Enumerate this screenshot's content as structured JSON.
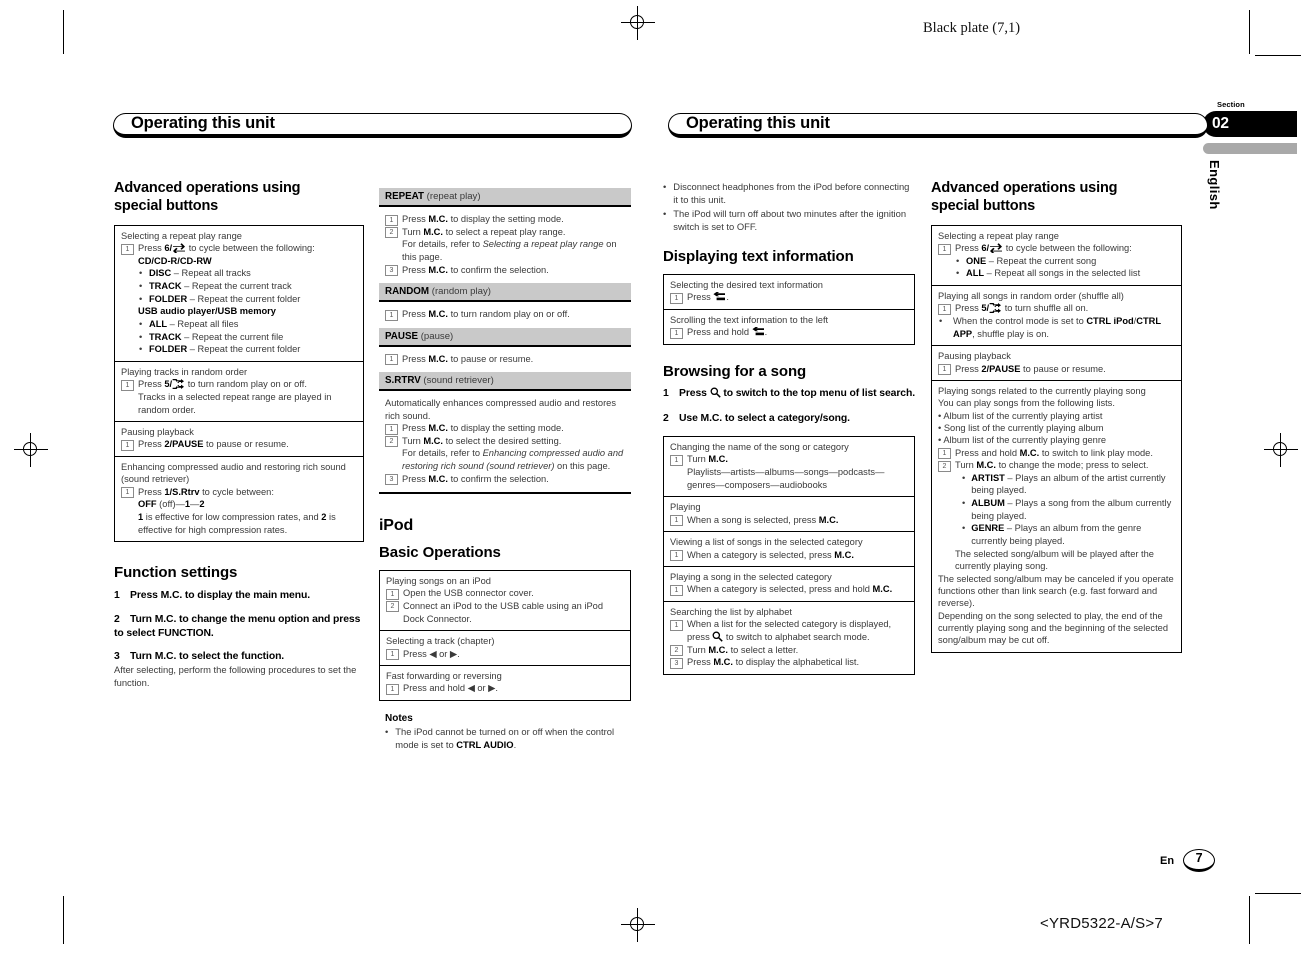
{
  "print_marks": {
    "plate_label": "Black plate (7,1)",
    "footer_code": "<YRD5322-A/S>7"
  },
  "section_tab": {
    "label": "Section",
    "number": "02",
    "language": "English"
  },
  "page_footer": {
    "lang_code": "En",
    "page_number": "7"
  },
  "running_head": {
    "left": "Operating this unit",
    "right": "Operating this unit"
  },
  "column1": {
    "heading": "Advanced operations using special buttons",
    "boxes": [
      {
        "title": "Selecting a repeat play range",
        "steps": [
          {
            "n": "1",
            "text_pre": "Press ",
            "bold": "6/",
            "icon": "repeat-icon",
            "text_post": " to cycle between the following:"
          }
        ],
        "group1_label": "CD/CD-R/CD-RW",
        "group1_items": [
          {
            "term": "DISC",
            "desc": " – Repeat all tracks"
          },
          {
            "term": "TRACK",
            "desc": " – Repeat the current track"
          },
          {
            "term": "FOLDER",
            "desc": " – Repeat the current folder"
          }
        ],
        "group2_label": "USB audio player/USB memory",
        "group2_items": [
          {
            "term": "ALL",
            "desc": " – Repeat all files"
          },
          {
            "term": "TRACK",
            "desc": " – Repeat the current file"
          },
          {
            "term": "FOLDER",
            "desc": " – Repeat the current folder"
          }
        ]
      },
      {
        "title": "Playing tracks in random order",
        "step_pre": "Press ",
        "step_bold": "5/",
        "step_icon": "shuffle-icon",
        "step_post": " to turn random play on or off.",
        "note": "Tracks in a selected repeat range are played in random order."
      },
      {
        "title": "Pausing playback",
        "step_pre": "Press ",
        "step_bold": "2/PAUSE",
        "step_post": " to pause or resume."
      },
      {
        "title": "Enhancing compressed audio and restoring rich sound (sound retriever)",
        "step_pre": "Press ",
        "step_bold": "1/S.Rtrv",
        "step_post": " to cycle between:",
        "values": "OFF (off)—1—2",
        "values_bold_1": "OFF",
        "values_plain_1": " (off)—",
        "values_bold_2": "1",
        "values_plain_2": "—",
        "values_bold_3": "2",
        "note_a": "1",
        "note_b": " is effective for low compression rates, and ",
        "note_c": "2",
        "note_d": " is effective for high compression rates."
      }
    ],
    "function_settings": {
      "heading": "Function settings",
      "steps": [
        {
          "n": "1",
          "text": "Press M.C. to display the main menu."
        },
        {
          "n": "2",
          "text": "Turn M.C. to change the menu option and press to select FUNCTION."
        },
        {
          "n": "3",
          "text": "Turn M.C. to select the function."
        }
      ],
      "after_note": "After selecting, perform the following procedures to set the function."
    }
  },
  "column2": {
    "strips": [
      {
        "name": "REPEAT",
        "paren": " (repeat play)",
        "lines": [
          {
            "n": "1",
            "pre": "Press ",
            "b": "M.C.",
            "post": " to display the setting mode."
          },
          {
            "n": "2",
            "pre": "Turn ",
            "b": "M.C.",
            "post": " to select a repeat play range."
          },
          {
            "cont": "For details, refer to ",
            "italic": "Selecting a repeat play range",
            "cont2": " on this page."
          },
          {
            "n": "3",
            "pre": "Press ",
            "b": "M.C.",
            "post": " to confirm the selection."
          }
        ]
      },
      {
        "name": "RANDOM",
        "paren": " (random play)",
        "lines": [
          {
            "n": "1",
            "pre": "Press ",
            "b": "M.C.",
            "post": " to turn random play on or off."
          }
        ]
      },
      {
        "name": "PAUSE",
        "paren": " (pause)",
        "lines": [
          {
            "n": "1",
            "pre": "Press ",
            "b": "M.C.",
            "post": " to pause or resume."
          }
        ]
      },
      {
        "name": "S.RTRV",
        "paren": " (sound retriever)",
        "intro": "Automatically enhances compressed audio and restores rich sound.",
        "lines": [
          {
            "n": "1",
            "pre": "Press ",
            "b": "M.C.",
            "post": " to display the setting mode."
          },
          {
            "n": "2",
            "pre": "Turn ",
            "b": "M.C.",
            "post": " to select the desired setting."
          },
          {
            "cont": "For details, refer to ",
            "italic": "Enhancing compressed audio and restoring rich sound (sound retriever)",
            "cont2": " on this page."
          },
          {
            "n": "3",
            "pre": "Press ",
            "b": "M.C.",
            "post": " to confirm the selection."
          }
        ]
      }
    ],
    "ipod_heading": "iPod",
    "basic_heading": "Basic Operations",
    "basic_boxes": [
      {
        "title": "Playing songs on an iPod",
        "steps": [
          {
            "n": "1",
            "text": "Open the USB connector cover."
          },
          {
            "n": "2",
            "text": "Connect an iPod to the USB cable using an iPod Dock Connector."
          }
        ]
      },
      {
        "title": "Selecting a track (chapter)",
        "steps": [
          {
            "n": "1",
            "text": "Press ◀ or ▶."
          }
        ]
      },
      {
        "title": "Fast forwarding or reversing",
        "steps": [
          {
            "n": "1",
            "text": "Press and hold ◀ or ▶."
          }
        ]
      }
    ],
    "notes_heading": "Notes",
    "notes": [
      {
        "pre": "The iPod cannot be turned on or off when the control mode is set to ",
        "b": "CTRL AUDIO",
        "post": "."
      }
    ]
  },
  "column3": {
    "top_notes": [
      {
        "text": "Disconnect headphones from the iPod before connecting it to this unit."
      },
      {
        "text": "The iPod will turn off about two minutes after the ignition switch is set to OFF."
      }
    ],
    "text_info_heading": "Displaying text information",
    "text_info_boxes": [
      {
        "title": "Selecting the desired text information",
        "step_n": "1",
        "step_pre": "Press ",
        "step_icon": "return-icon",
        "step_post": "."
      },
      {
        "title": "Scrolling the text information to the left",
        "step_n": "1",
        "step_pre": "Press and hold ",
        "step_icon": "return-icon",
        "step_post": "."
      }
    ],
    "browsing_heading": "Browsing for a song",
    "browsing_steps": [
      {
        "n": "1",
        "pre": "Press ",
        "icon": "search-icon",
        "post": " to switch to the top menu of list search."
      },
      {
        "n": "2",
        "pre": "Use M.C. to select a category/song.",
        "icon": "",
        "post": ""
      }
    ],
    "browsing_boxes": [
      {
        "title": "Changing the name of the song or category",
        "step_n": "1",
        "step_pre": "Turn ",
        "step_b": "M.C.",
        "sub1": "Playlists—artists—albums—songs—podcasts—genres—composers—audiobooks"
      },
      {
        "title": "Playing",
        "step_n": "1",
        "step_pre": "When a song is selected, press ",
        "step_b": "M.C."
      },
      {
        "title": "Viewing a list of songs in the selected category",
        "step_n": "1",
        "step_pre": "When a category is selected, press ",
        "step_b": "M.C."
      },
      {
        "title": "Playing a song in the selected category",
        "step_n": "1",
        "step_pre": "When a category is selected, press and hold ",
        "step_b": "M.C."
      },
      {
        "title": "Searching the list by alphabet",
        "step_n": "1",
        "step_pre": "When a list for the selected category is displayed, press ",
        "step_icon": "search-icon",
        "step_post": " to switch to alphabet search mode.",
        "step2_n": "2",
        "step2_pre": "Turn ",
        "step2_b": "M.C.",
        "step2_post": " to select a letter.",
        "step3_n": "3",
        "step3_pre": "Press ",
        "step3_b": "M.C.",
        "step3_post": " to display the alphabetical list."
      }
    ]
  },
  "column4": {
    "heading": "Advanced operations using special buttons",
    "boxes": [
      {
        "title": "Selecting a repeat play range",
        "step_n": "1",
        "step_pre": "Press ",
        "step_bold": "6/",
        "step_icon": "repeat-icon",
        "step_post": " to cycle between the following:",
        "items": [
          {
            "term": "ONE",
            "desc": " – Repeat the current song"
          },
          {
            "term": "ALL",
            "desc": " – Repeat all songs in the selected list"
          }
        ]
      },
      {
        "title": "Playing all songs in random order (shuffle all)",
        "step_n": "1",
        "step_pre": "Press ",
        "step_bold": "5/",
        "step_icon": "shuffle-icon",
        "step_post": " to turn shuffle all on.",
        "bullet_pre": "When the control mode is set to ",
        "bullet_b1": "CTRL iPod",
        "bullet_mid": "/",
        "bullet_b2": "CTRL APP",
        "bullet_post": ", shuffle play is on."
      },
      {
        "title": "Pausing playback",
        "step_n": "1",
        "step_pre": "Press ",
        "step_bold": "2/PAUSE",
        "step_post": " to pause or resume."
      },
      {
        "title": "Playing songs related to the currently playing song",
        "intro": "You can play songs from the following lists.",
        "list": [
          "Album list of the currently playing artist",
          "Song list of the currently playing album",
          "Album list of the currently playing genre"
        ],
        "step1_n": "1",
        "step1_pre": "Press and hold ",
        "step1_b": "M.C.",
        "step1_post": " to switch to link play mode.",
        "step2_n": "2",
        "step2_pre": "Turn ",
        "step2_b": "M.C.",
        "step2_post": " to change the mode; press to select.",
        "modes": [
          {
            "term": "ARTIST",
            "desc": " – Plays an album of the artist currently being played."
          },
          {
            "term": "ALBUM",
            "desc": " – Plays a song from the album currently being played."
          },
          {
            "term": "GENRE",
            "desc": " – Plays an album from the genre currently being played."
          }
        ],
        "after_modes": "The selected song/album will be played after the currently playing song.",
        "trailing": [
          "The selected song/album may be canceled if you operate functions other than link search (e.g. fast forward and reverse).",
          "Depending on the song selected to play, the end of the currently playing song and the beginning of the selected song/album may be cut off."
        ]
      }
    ]
  },
  "colors": {
    "strip_bg": "#c9c9c9",
    "body_text": "#3a3a3a",
    "rule": "#000000"
  }
}
